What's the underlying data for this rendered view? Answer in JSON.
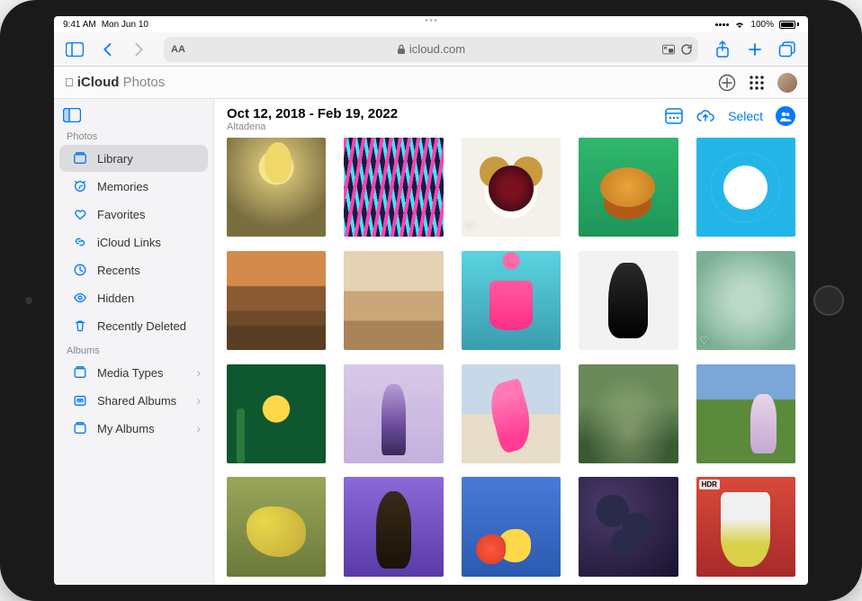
{
  "status": {
    "time": "9:41 AM",
    "date": "Mon Jun 10",
    "battery_pct": "100%"
  },
  "safari": {
    "url_host": "icloud.com"
  },
  "app": {
    "brand_prefix": "iCloud",
    "brand_suffix": "Photos"
  },
  "sidebar": {
    "sections": [
      {
        "header": "Photos",
        "items": [
          {
            "icon": "library",
            "label": "Library",
            "selected": true,
            "disclosure": false
          },
          {
            "icon": "memories",
            "label": "Memories",
            "selected": false,
            "disclosure": false
          },
          {
            "icon": "heart",
            "label": "Favorites",
            "selected": false,
            "disclosure": false
          },
          {
            "icon": "link",
            "label": "iCloud Links",
            "selected": false,
            "disclosure": false
          },
          {
            "icon": "clock",
            "label": "Recents",
            "selected": false,
            "disclosure": false
          },
          {
            "icon": "eye",
            "label": "Hidden",
            "selected": false,
            "disclosure": false
          },
          {
            "icon": "trash",
            "label": "Recently Deleted",
            "selected": false,
            "disclosure": false
          }
        ]
      },
      {
        "header": "Albums",
        "items": [
          {
            "icon": "album",
            "label": "Media Types",
            "selected": false,
            "disclosure": true
          },
          {
            "icon": "shared",
            "label": "Shared Albums",
            "selected": false,
            "disclosure": true
          },
          {
            "icon": "album",
            "label": "My Albums",
            "selected": false,
            "disclosure": true
          }
        ]
      }
    ]
  },
  "main": {
    "date_range": "Oct 12, 2018 - Feb 19, 2022",
    "location": "Altadena",
    "select_label": "Select",
    "photos": [
      {
        "desc": "person-in-water-with-yellow-float",
        "favorite": false,
        "hdr": false
      },
      {
        "desc": "neon-lights-building",
        "favorite": false,
        "hdr": false
      },
      {
        "desc": "pastries-on-plate",
        "favorite": true,
        "hdr": false
      },
      {
        "desc": "bread-on-green",
        "favorite": false,
        "hdr": false
      },
      {
        "desc": "colorful-cookies-on-plate",
        "favorite": false,
        "hdr": false
      },
      {
        "desc": "red-rock-canyon-tall",
        "favorite": false,
        "hdr": false
      },
      {
        "desc": "desert-landscape",
        "favorite": false,
        "hdr": false
      },
      {
        "desc": "pink-cake-candles",
        "favorite": false,
        "hdr": false
      },
      {
        "desc": "bw-portrait-woman",
        "favorite": false,
        "hdr": false
      },
      {
        "desc": "succulent-closeup",
        "favorite": true,
        "hdr": false
      },
      {
        "desc": "yellow-flower-green-bg",
        "favorite": false,
        "hdr": false
      },
      {
        "desc": "person-sweater-outdoor",
        "favorite": false,
        "hdr": false
      },
      {
        "desc": "woman-pink-dress-beach",
        "favorite": false,
        "hdr": false
      },
      {
        "desc": "forest-mountain-vista",
        "favorite": false,
        "hdr": false
      },
      {
        "desc": "woman-striped-sweater-meadow",
        "favorite": false,
        "hdr": false
      },
      {
        "desc": "yellow-corn-closeup",
        "favorite": false,
        "hdr": false
      },
      {
        "desc": "man-orange-shirt-purple",
        "favorite": false,
        "hdr": false
      },
      {
        "desc": "still-life-fruit-blue",
        "favorite": false,
        "hdr": false
      },
      {
        "desc": "dark-grapes-closeup",
        "favorite": false,
        "hdr": false
      },
      {
        "desc": "person-red-dress-doorway",
        "favorite": false,
        "hdr": true
      }
    ]
  }
}
